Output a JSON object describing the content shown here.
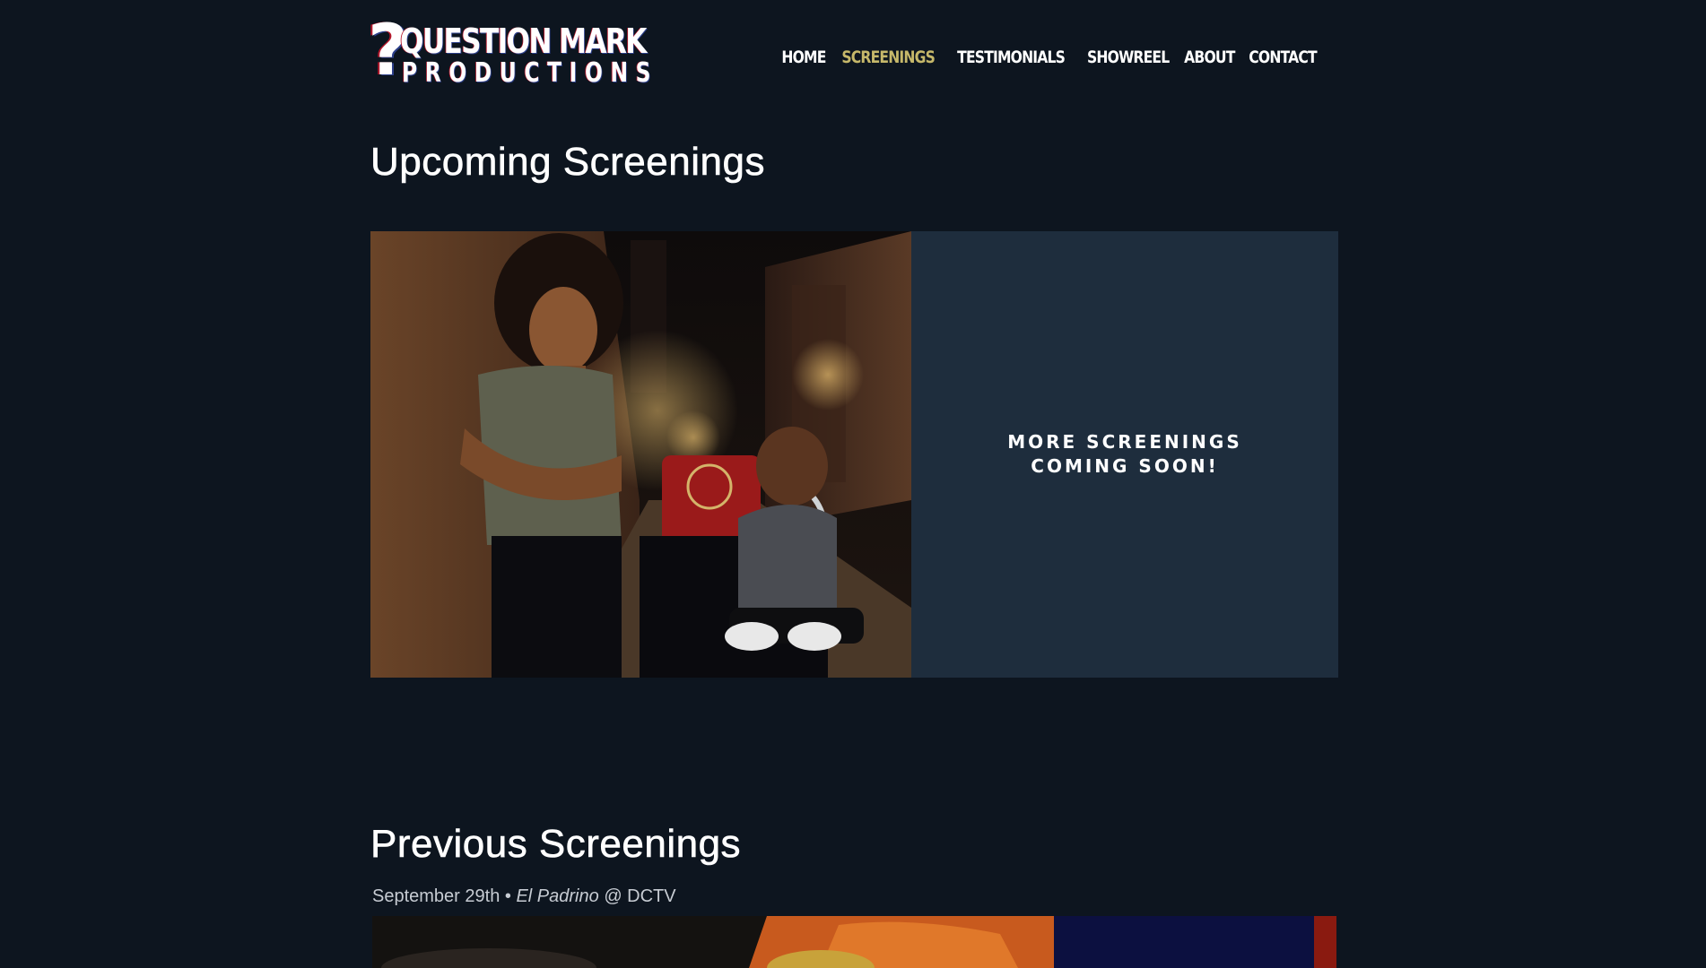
{
  "header": {
    "logo": {
      "mark": "?",
      "line1": "QUESTION MARK",
      "line2": "PRODUCTIONS"
    },
    "nav": [
      {
        "label": "HOME",
        "active": false
      },
      {
        "label": "SCREENINGS",
        "active": true
      },
      {
        "label": "TESTIMONIALS",
        "active": false
      },
      {
        "label": "SHOWREEL",
        "active": false
      },
      {
        "label": "ABOUT",
        "active": false
      },
      {
        "label": "CONTACT",
        "active": false
      }
    ]
  },
  "upcoming": {
    "title": "Upcoming Screenings",
    "panel_text": "MORE SCREENINGS COMING SOON!"
  },
  "previous": {
    "title": "Previous Screenings",
    "entries": [
      {
        "date": "September 29th",
        "separator": "•",
        "film": "El Padrino",
        "venue": "@ DCTV"
      }
    ]
  },
  "colors": {
    "background": "#0d151f",
    "panel": "#1e2d3d",
    "nav_active": "#c6b86a",
    "text": "#ffffff"
  }
}
